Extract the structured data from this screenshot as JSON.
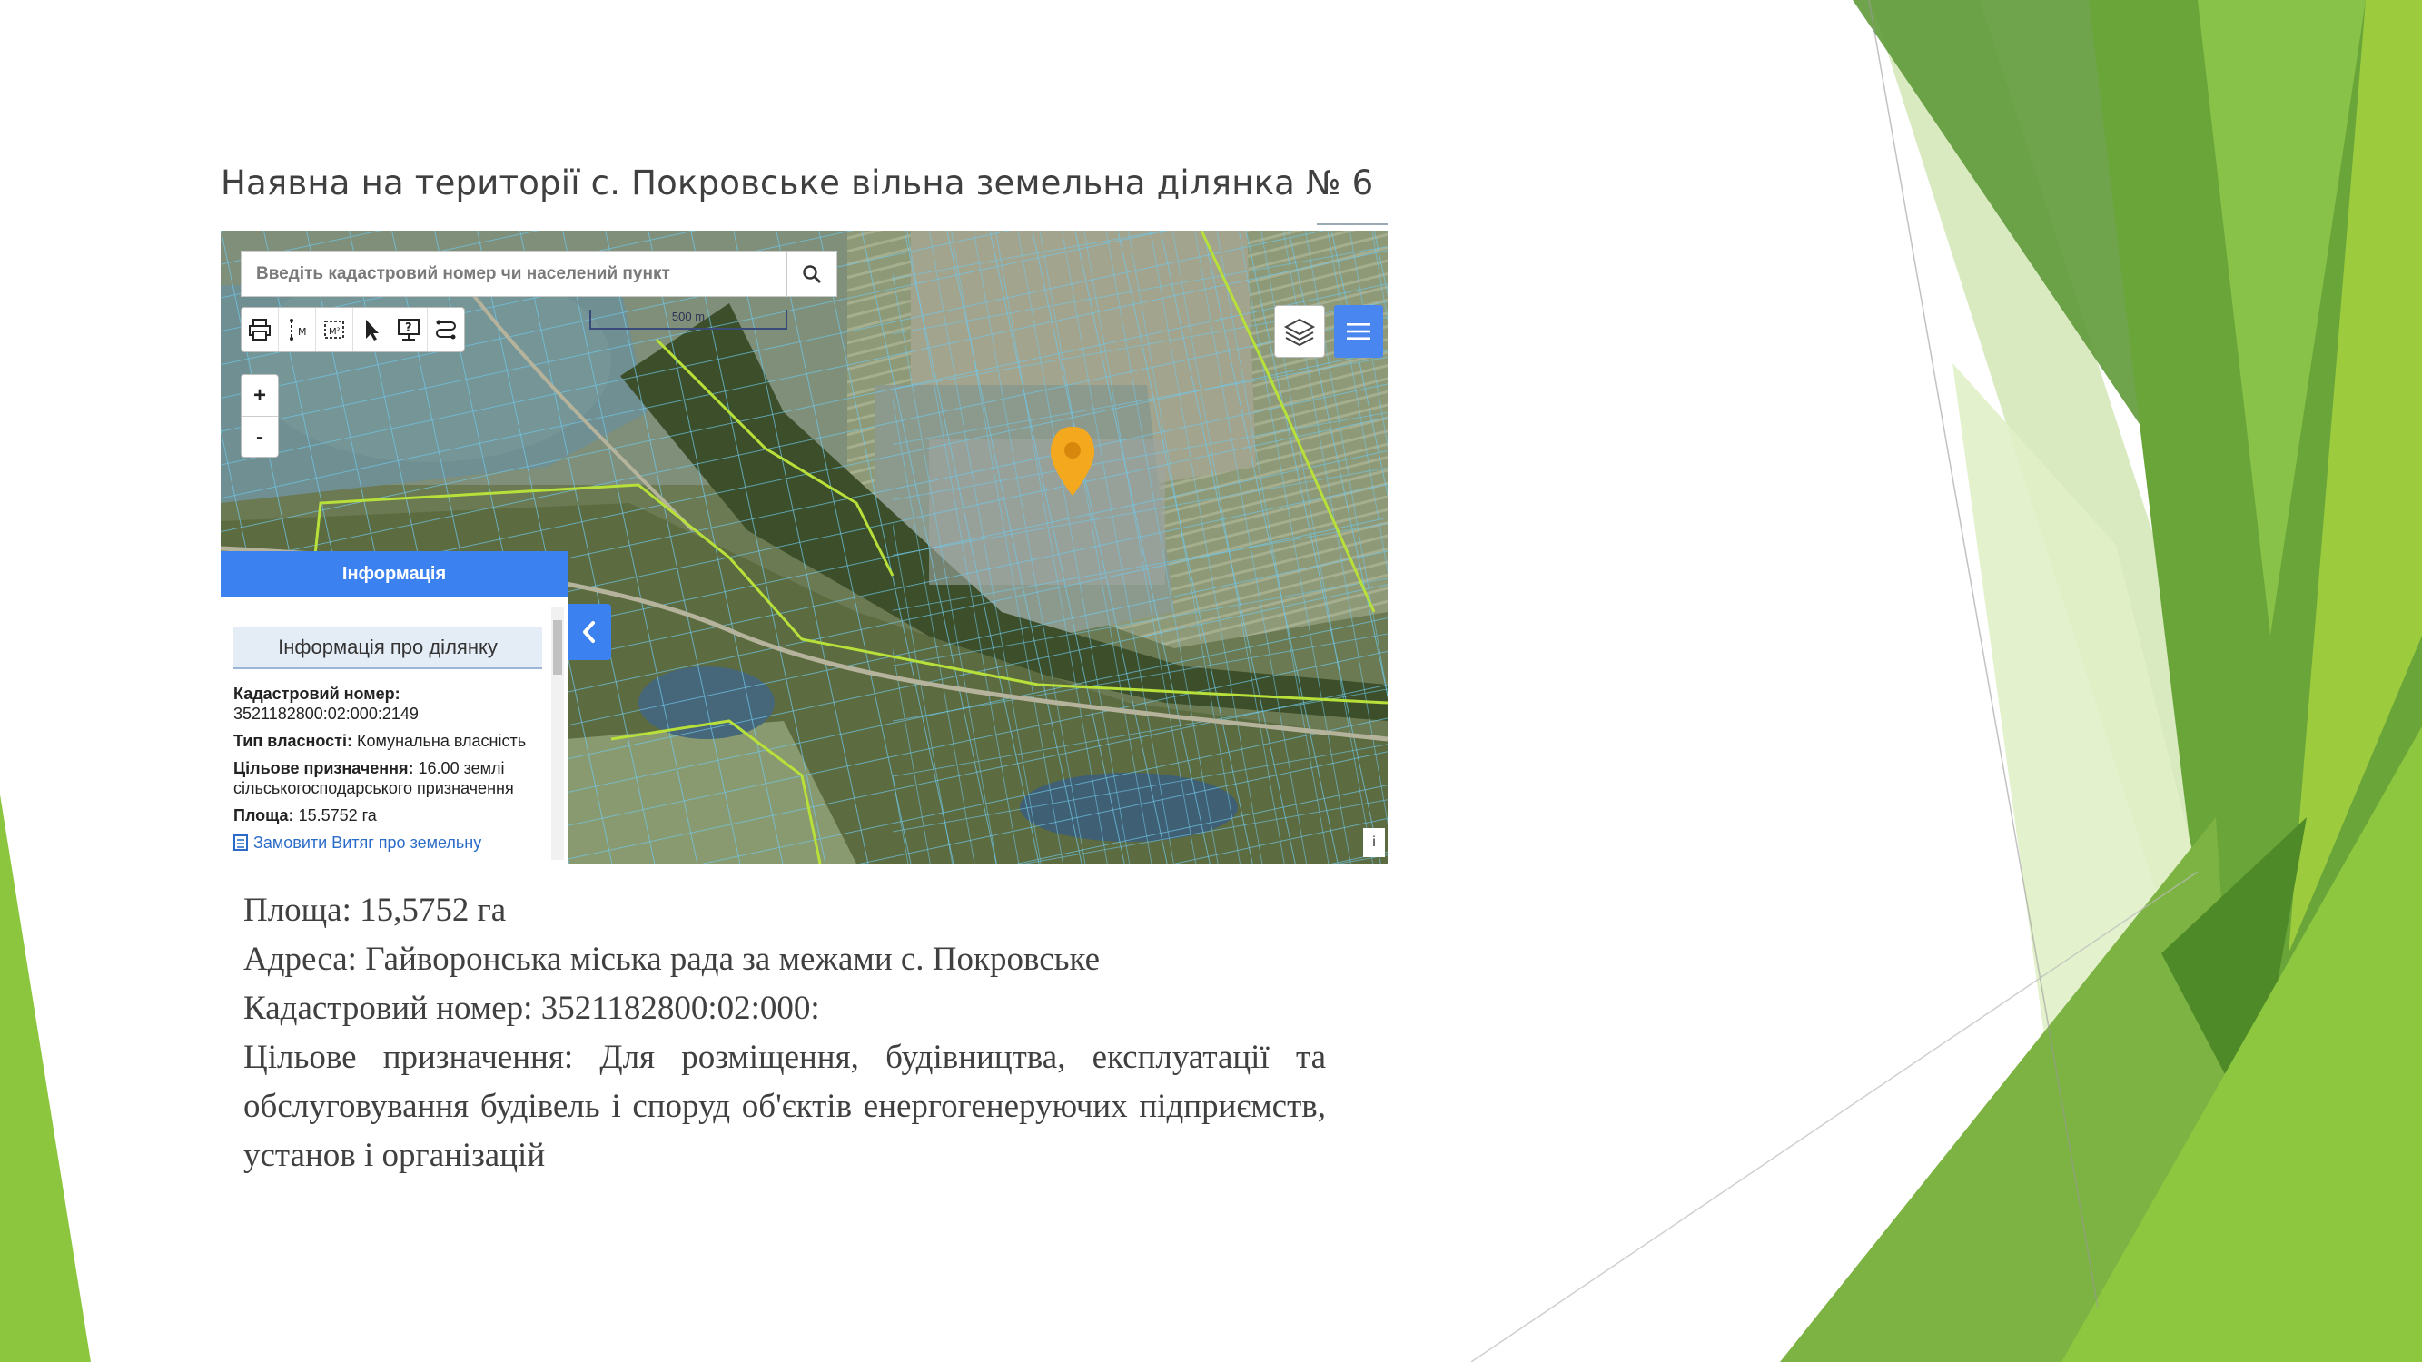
{
  "slide": {
    "title": "Наявна на території с. Покровське вільна земельна ділянка № 6",
    "body": {
      "area": "Площа: 15,5752 га",
      "address": "Адреса: Гайворонська міська рада за межами с. Покровське",
      "cadastral": "Кадастровий номер: 3521182800:02:000:",
      "purpose": "Цільове призначення: Для розміщення, будівництва, експлуатації та обслуговування будівель і споруд об'єктів енергогенеруючих підприємств, установ і організацій"
    }
  },
  "map": {
    "search_placeholder": "Введіть кадастровий номер чи населений пункт",
    "scale_label": "500 m",
    "zoom_in": "+",
    "zoom_out": "-",
    "attribution": "i",
    "info_panel": {
      "header": "Інформація",
      "subheader": "Інформація про ділянку",
      "cadastral_label": "Кадастровий номер:",
      "cadastral_value": "3521182800:02:000:2149",
      "ownership_label": "Тип власності:",
      "ownership_value": "Комунальна власність",
      "purpose_label": "Цільове призначення:",
      "purpose_value": "16.00 землі сільськогосподарського призначення",
      "area_label": "Площа:",
      "area_value": "15.5752 га",
      "order_link": "Замовити Витяг про земельну"
    },
    "toolbar_icons": [
      "print-icon",
      "measure-line-icon",
      "measure-area-icon",
      "pointer-icon",
      "info-query-icon",
      "route-icon"
    ]
  },
  "colors": {
    "accent_blue": "#3b82f0",
    "parcel_line": "#6fc8ea",
    "boundary_green": "#b8e03a",
    "marker": "#f4a81d",
    "deco_green_dark": "#5f9a2e",
    "deco_green_light": "#8cc63f"
  }
}
